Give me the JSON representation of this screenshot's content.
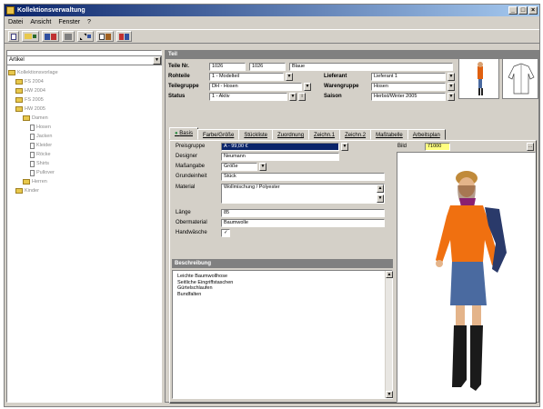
{
  "window": {
    "title": "Kollektionsverwaltung",
    "controls": [
      "_",
      "□",
      "×"
    ]
  },
  "menu": [
    "Datei",
    "Ansicht",
    "Fenster",
    "?"
  ],
  "toolbar": {
    "buttons": [
      "new",
      "open",
      "save",
      "print",
      "cut",
      "copy",
      "paste",
      "help"
    ]
  },
  "tree": {
    "selector": "Artikel",
    "items": [
      {
        "label": "Kollektionsvorlage",
        "level": 0,
        "type": "folder"
      },
      {
        "label": "FS 2004",
        "level": 1,
        "type": "folder"
      },
      {
        "label": "HW 2004",
        "level": 1,
        "type": "folder"
      },
      {
        "label": "FS 2005",
        "level": 1,
        "type": "folder"
      },
      {
        "label": "HW 2005",
        "level": 1,
        "type": "folder"
      },
      {
        "label": "Damen",
        "level": 2,
        "type": "folder"
      },
      {
        "label": "Hosen",
        "level": 3,
        "type": "doc"
      },
      {
        "label": "Jacken",
        "level": 3,
        "type": "doc"
      },
      {
        "label": "Kleider",
        "level": 3,
        "type": "doc"
      },
      {
        "label": "Röcke",
        "level": 3,
        "type": "doc"
      },
      {
        "label": "Shirts",
        "level": 3,
        "type": "doc"
      },
      {
        "label": "Pullover",
        "level": 3,
        "type": "doc"
      },
      {
        "label": "Herren",
        "level": 2,
        "type": "folder"
      },
      {
        "label": "Kinder",
        "level": 1,
        "type": "folder"
      }
    ]
  },
  "section_title": "Teil",
  "header_fields": {
    "teil_nr_label": "Teile Nr.",
    "teil_nr": "1026",
    "teil_nr2": "1026",
    "teil_name": "Blaue",
    "rohteile_label": "Rohteile",
    "rohteile": "1 - Modelteil",
    "teilegruppe_label": "Teilegruppe",
    "teilegruppe": "DH - Hosen",
    "status_label": "Status",
    "status": "1 - Aktiv",
    "lieferant_label": "Lieferant",
    "lieferant": "Lieferant 1",
    "warengruppe_label": "Warengruppe",
    "warengruppe": "Hosen",
    "saison_label": "Saison",
    "saison": "Herbst/Winter 2005"
  },
  "tabs": [
    "Basis",
    "Farbe/Größe",
    "Stückliste",
    "Zuordnung",
    "Zeichn.1",
    "Zeichn.2",
    "Maßtabelle",
    "Arbeitsplan"
  ],
  "basis": {
    "rows": [
      {
        "label": "Preisgruppe",
        "value": "A - 99,00 €"
      },
      {
        "label": "Designer",
        "value": "Neumann"
      },
      {
        "label": "Maßangabe",
        "value": "Größe"
      },
      {
        "label": "Grundeinheit",
        "value": "Stück"
      },
      {
        "label": "Material",
        "value": "Wollmischung / Polyester"
      },
      {
        "label": "Länge",
        "value": "85"
      },
      {
        "label": "Obermaterial",
        "value": "Baumwolle"
      },
      {
        "label": "Handwäsche",
        "value": "✓"
      }
    ],
    "bild_label": "Bild",
    "bild_value": "71000"
  },
  "description": {
    "header": "Beschreibung",
    "lines": [
      "Leichte Baumwollhose",
      "Seitliche Eingriffstaschen",
      "Gürtelschlaufen",
      "Bundfalten"
    ]
  },
  "icons": {
    "folder": "folder-icon",
    "document": "document-icon",
    "dropdown": "chevron-down-icon",
    "info": "info-icon"
  },
  "colors": {
    "title_start": "#0a246a",
    "title_end": "#a6caf0",
    "face": "#d4d0c8",
    "section": "#808080",
    "selection": "#0a246a",
    "folder": "#e8c84c"
  }
}
